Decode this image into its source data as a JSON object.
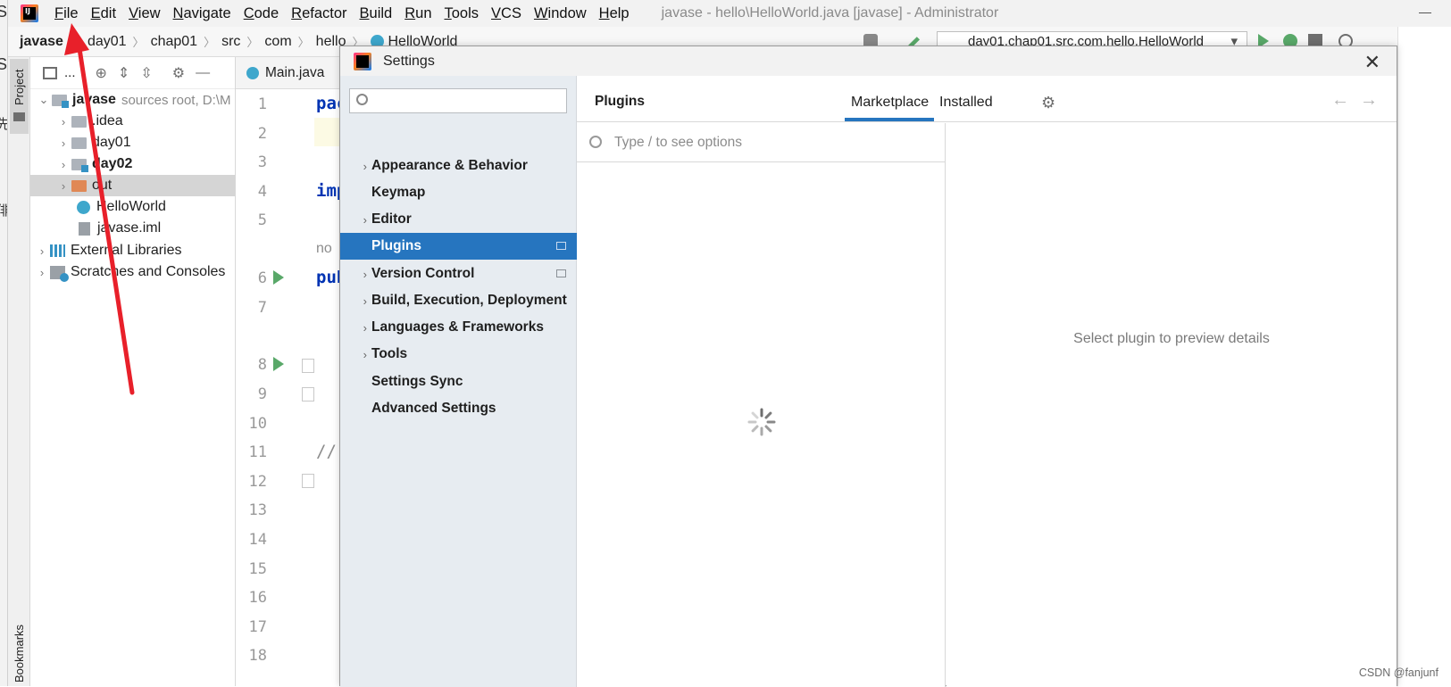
{
  "menubar": {
    "logo_text": "IJ",
    "items": [
      "File",
      "Edit",
      "View",
      "Navigate",
      "Code",
      "Refactor",
      "Build",
      "Run",
      "Tools",
      "VCS",
      "Window",
      "Help"
    ],
    "window_title": "javase - hello\\HelloWorld.java [javase] - Administrator"
  },
  "edge_chars": [
    "S",
    "先",
    "俳"
  ],
  "breadcrumb": {
    "items": [
      "javase",
      "day01",
      "chap01",
      "src",
      "com",
      "hello",
      "HelloWorld"
    ],
    "run_config": "day01.chap01.src.com.hello.HelloWorld"
  },
  "toolstrip": {
    "project_label": "Project",
    "bookmarks_label": "Bookmarks"
  },
  "project_panel": {
    "title": "...",
    "tree": {
      "root_name": "javase",
      "root_hint": "sources root,  D:\\M",
      "children": [
        ".idea",
        "day01",
        "day02",
        "out",
        "HelloWorld",
        "javase.iml"
      ],
      "external_libraries": "External Libraries",
      "scratches": "Scratches and Consoles"
    }
  },
  "editor": {
    "tab_label": "Main.java",
    "line_numbers": [
      "1",
      "2",
      "3",
      "4",
      "5",
      "6",
      "7",
      "8",
      "9",
      "10",
      "11",
      "12",
      "13",
      "14",
      "15",
      "16",
      "17",
      "18"
    ],
    "code": {
      "line1": "pac",
      "line4": "imp",
      "inlay": "no",
      "line6": "pub",
      "line11": "//"
    }
  },
  "settings": {
    "title": "Settings",
    "search_value": "",
    "nav": [
      {
        "label": "Appearance & Behavior",
        "expandable": true
      },
      {
        "label": "Keymap",
        "expandable": false
      },
      {
        "label": "Editor",
        "expandable": true
      },
      {
        "label": "Plugins",
        "expandable": false,
        "selected": true
      },
      {
        "label": "Version Control",
        "expandable": true
      },
      {
        "label": "Build, Execution, Deployment",
        "expandable": true
      },
      {
        "label": "Languages & Frameworks",
        "expandable": true
      },
      {
        "label": "Tools",
        "expandable": true
      },
      {
        "label": "Settings Sync",
        "expandable": false
      },
      {
        "label": "Advanced Settings",
        "expandable": false
      }
    ],
    "plugins": {
      "title": "Plugins",
      "tab_marketplace": "Marketplace",
      "tab_installed": "Installed",
      "active_tab": "Marketplace",
      "search_placeholder": "Type / to see options",
      "details_placeholder": "Select plugin to preview details"
    }
  },
  "watermark": "CSDN @fanjunf",
  "colors": {
    "selection_blue": "#2675bf",
    "nav_background": "#e7ecf1",
    "annotation_red": "#e8202a",
    "run_green": "#59a869"
  }
}
